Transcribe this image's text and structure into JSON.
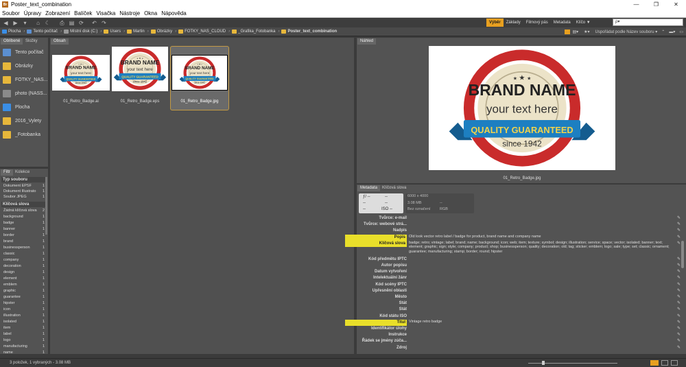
{
  "window": {
    "title": "Poster_text_combination",
    "app_icon": "Br",
    "controls": [
      "—",
      "❐",
      "✕"
    ]
  },
  "menu": [
    "Soubor",
    "Úpravy",
    "Zobrazení",
    "Balíček",
    "Visačka",
    "Nástroje",
    "Okna",
    "Nápověda"
  ],
  "workspaces": {
    "items": [
      "Výběr",
      "Základy",
      "Filmový pás",
      "Metadata",
      "Klíčo ▼"
    ],
    "active": "Výběr"
  },
  "search": {
    "placeholder": "ρ▾"
  },
  "breadcrumbs": [
    "Plocha",
    "Tento počítač",
    "Místní disk (C:)",
    "Users",
    "Martin",
    "Obrázky",
    "FOTKY_NAS_CLOUD",
    "_Grafika_Fotobanka",
    "Poster_text_combination"
  ],
  "sort_label": "Uspořádat podle Název souboru ▾",
  "favorites": {
    "tabs": [
      "Oblíbené",
      "Složky"
    ],
    "items": [
      "Tento počítač",
      "Obrázky",
      "FOTKY_NAS...",
      "photo (NASS...",
      "Plocha",
      "2016_Vylety",
      "_Fotobanka"
    ]
  },
  "filter": {
    "tabs": [
      "Filtr",
      "Kolekce"
    ],
    "file_type_header": "Typ souboru",
    "file_types": [
      [
        "Dokument EPSF",
        "1"
      ],
      [
        "Dokument Illustrato",
        "1"
      ],
      [
        "Soubor JPEG",
        "1"
      ]
    ],
    "keywords_header": "Klíčová slova",
    "keywords": [
      [
        "Žádná klíčová slova",
        "2"
      ],
      [
        "background",
        "1"
      ],
      [
        "badge",
        "1"
      ],
      [
        "banner",
        "1"
      ],
      [
        "border",
        "1"
      ],
      [
        "brand",
        "1"
      ],
      [
        "businessperson",
        "1"
      ],
      [
        "classic",
        "1"
      ],
      [
        "company",
        "1"
      ],
      [
        "decoration",
        "1"
      ],
      [
        "design",
        "1"
      ],
      [
        "element",
        "1"
      ],
      [
        "emblem",
        "1"
      ],
      [
        "graphic",
        "1"
      ],
      [
        "guarantee",
        "1"
      ],
      [
        "hipster",
        "1"
      ],
      [
        "icon",
        "1"
      ],
      [
        "illustration",
        "1"
      ],
      [
        "isolated",
        "1"
      ],
      [
        "item",
        "1"
      ],
      [
        "label",
        "1"
      ],
      [
        "logo",
        "1"
      ],
      [
        "manufacturing",
        "1"
      ],
      [
        "name",
        "1"
      ]
    ]
  },
  "content": {
    "tab": "Obsah",
    "items": [
      {
        "name": "01_Retro_Badge.ai"
      },
      {
        "name": "01_Retro_Badge.eps"
      },
      {
        "name": "01_Retro_Badge.jpg",
        "selected": true
      }
    ]
  },
  "badge": {
    "brand": "BRAND NAME",
    "sub": "your text here",
    "ribbon": "QUALITY GUARANTEED",
    "since": "since 1942"
  },
  "preview": {
    "tab": "Náhled",
    "caption": "01_Retro_Badge.jpg"
  },
  "metadata": {
    "tabs": [
      "Metadata",
      "Klíčová slova"
    ],
    "exposure": [
      "ƒ/ --",
      "--",
      "--",
      "--",
      "--",
      "ISO --"
    ],
    "file_info": [
      "6000 x 4000",
      "3.08 MB",
      "--",
      "Bez označení",
      "RGB"
    ],
    "fields": [
      {
        "k": "Tvůrce: e-mail",
        "v": "",
        "hl": false
      },
      {
        "k": "Tvůrce: webové strá...",
        "v": "",
        "hl": false
      },
      {
        "k": "Nadpis",
        "v": "",
        "hl": false
      },
      {
        "k": "Popis",
        "v": "Old look vector retro label / badge for product, brand name and company name",
        "hl": true
      },
      {
        "k": "Klíčová slova",
        "v": "badge; retro; vintage; label; brand; name; background; icon; web; item; texture; symbol; design; illustration; service; space; vector; isolated; banner; text; element; graphic; sign; style; company; product; shop; businessperson; quality; decoration; old; tag; sticker; emblem; logo; sale; type; set; classic; ornament; guarantee; manufacturing; stamp; border; round; hipster",
        "hl": true
      },
      {
        "k": "Kód předmětu IPTC",
        "v": "",
        "hl": false
      },
      {
        "k": "Autor popisu",
        "v": "",
        "hl": false
      },
      {
        "k": "Datum vytvoření",
        "v": "",
        "hl": false
      },
      {
        "k": "Intelektuální žánr",
        "v": "",
        "hl": false
      },
      {
        "k": "Kód scény IPTC",
        "v": "",
        "hl": false
      },
      {
        "k": "Upřesnění oblasti",
        "v": "",
        "hl": false
      },
      {
        "k": "Město",
        "v": "",
        "hl": false
      },
      {
        "k": "Stát",
        "v": "",
        "hl": false
      },
      {
        "k": "Stát",
        "v": "",
        "hl": false
      },
      {
        "k": "Kód státu ISO",
        "v": "",
        "hl": false
      },
      {
        "k": "Titul",
        "v": "Vintage retro badge",
        "hl": true
      },
      {
        "k": "Identifikátor úlohy",
        "v": "",
        "hl": false
      },
      {
        "k": "Instrukce",
        "v": "",
        "hl": false
      },
      {
        "k": "Řádek se jmény zúča...",
        "v": "",
        "hl": false
      },
      {
        "k": "Zdroj",
        "v": "",
        "hl": false
      }
    ]
  },
  "status": "3 položek, 1 vybraných - 3.08 MB",
  "colors": {
    "accent": "#e8a020",
    "panel": "#535353",
    "folder": "#e7b73b",
    "badge_red": "#c92b2b",
    "badge_blue": "#1d7fc1",
    "badge_cream": "#ece3c8"
  }
}
